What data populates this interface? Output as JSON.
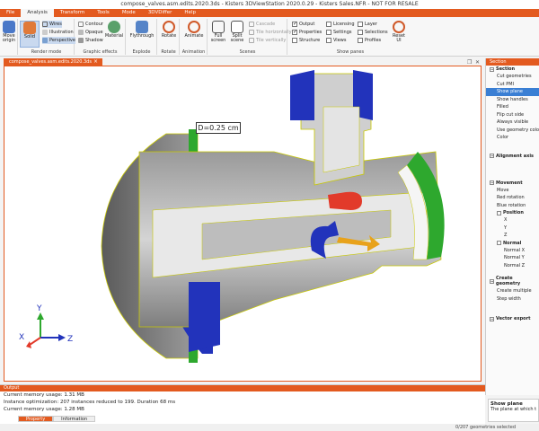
{
  "window": {
    "title": "compose_valves.asm.edits.2020.3ds - Kisters 3DViewStation 2020.0.29 - Kisters Sales.NFR - NOT FOR RESALE"
  },
  "menu": {
    "items": [
      {
        "label": "File"
      },
      {
        "label": "Analysis"
      },
      {
        "label": "Transform"
      },
      {
        "label": "Tools"
      },
      {
        "label": "Mode"
      },
      {
        "label": "3DVDiffer"
      },
      {
        "label": "Help"
      }
    ],
    "active_index": 1
  },
  "ribbon": {
    "move_origin_label": "Move\norigin",
    "render_mode": {
      "label": "Render mode",
      "solid": "Solid",
      "wires": "Wires",
      "illustration": "Illustration",
      "perspective": "Perspective"
    },
    "graphic_effects": {
      "label": "Graphic effects",
      "contour": "Contour",
      "opaque": "Opaque",
      "shadow": "Shadow",
      "material": "Material"
    },
    "explode": {
      "label": "Explode",
      "flythrough": "Flythrough"
    },
    "rotate": {
      "label": "Rotate",
      "rotate_btn": "Rotate"
    },
    "animation": {
      "label": "Animation",
      "animate": "Animate"
    },
    "scenes": {
      "label": "Scenes",
      "full_screen": "Full\nscreen",
      "split_scene": "Split\nscene",
      "cascade": "Cascade",
      "tile_horizontally": "Tile horizontally",
      "tile_vertically": "Tile vertically"
    },
    "show_panes": {
      "label": "Show panes",
      "output": "Output",
      "properties": "Properties",
      "structure": "Structure",
      "licensing": "Licensing",
      "settings": "Settings",
      "views": "Views",
      "layer": "Layer",
      "selections": "Selections",
      "profiles": "Profiles",
      "reset_ui": "Reset\nUI"
    }
  },
  "document_tab": {
    "label": "compose_valves.asm.edits.2020.3ds"
  },
  "viewport": {
    "measurement": "D=0.25 cm",
    "axes": {
      "x": "X",
      "y": "Y",
      "z": "Z"
    },
    "colors": {
      "blue": "#2233bb",
      "green": "#2ea82e",
      "red": "#e23a2a",
      "orange": "#e8a21b"
    }
  },
  "right_panel": {
    "header": "Section",
    "section": {
      "title": "Section",
      "items": [
        "Cut geometries",
        "Cut PMI",
        "Show plane",
        "Show handles",
        "Filled",
        "Flip cut side",
        "Always visible",
        "Use geometry color",
        "Color"
      ],
      "selected_index": 2
    },
    "alignment_axis": {
      "title": "Alignment axis"
    },
    "movement": {
      "title": "Movement",
      "items": [
        "Move",
        "Red rotation",
        "Blue rotation"
      ],
      "position": {
        "title": "Position",
        "items": [
          "X",
          "Y",
          "Z"
        ]
      },
      "normal": {
        "title": "Normal",
        "items": [
          "Normal X",
          "Normal Y",
          "Normal Z"
        ]
      }
    },
    "create_geometry": {
      "title": "Create geometry",
      "items": [
        "Create multiple",
        "Step width"
      ]
    },
    "vector_export": {
      "title": "Vector export"
    }
  },
  "output_pane": {
    "header": "Output",
    "lines": [
      "Current memory usage: 1.31 MB",
      "Instance optimization: 207 instances reduced to 199. Duration 68 ms",
      "Current memory usage: 1.28 MB"
    ]
  },
  "bottom_tabs": [
    {
      "label": "Property"
    },
    {
      "label": "Information"
    }
  ],
  "info_box": {
    "title": "Show plane",
    "text": "The plane at which the"
  },
  "status_bar": {
    "text": "0/207 geometries selected"
  }
}
